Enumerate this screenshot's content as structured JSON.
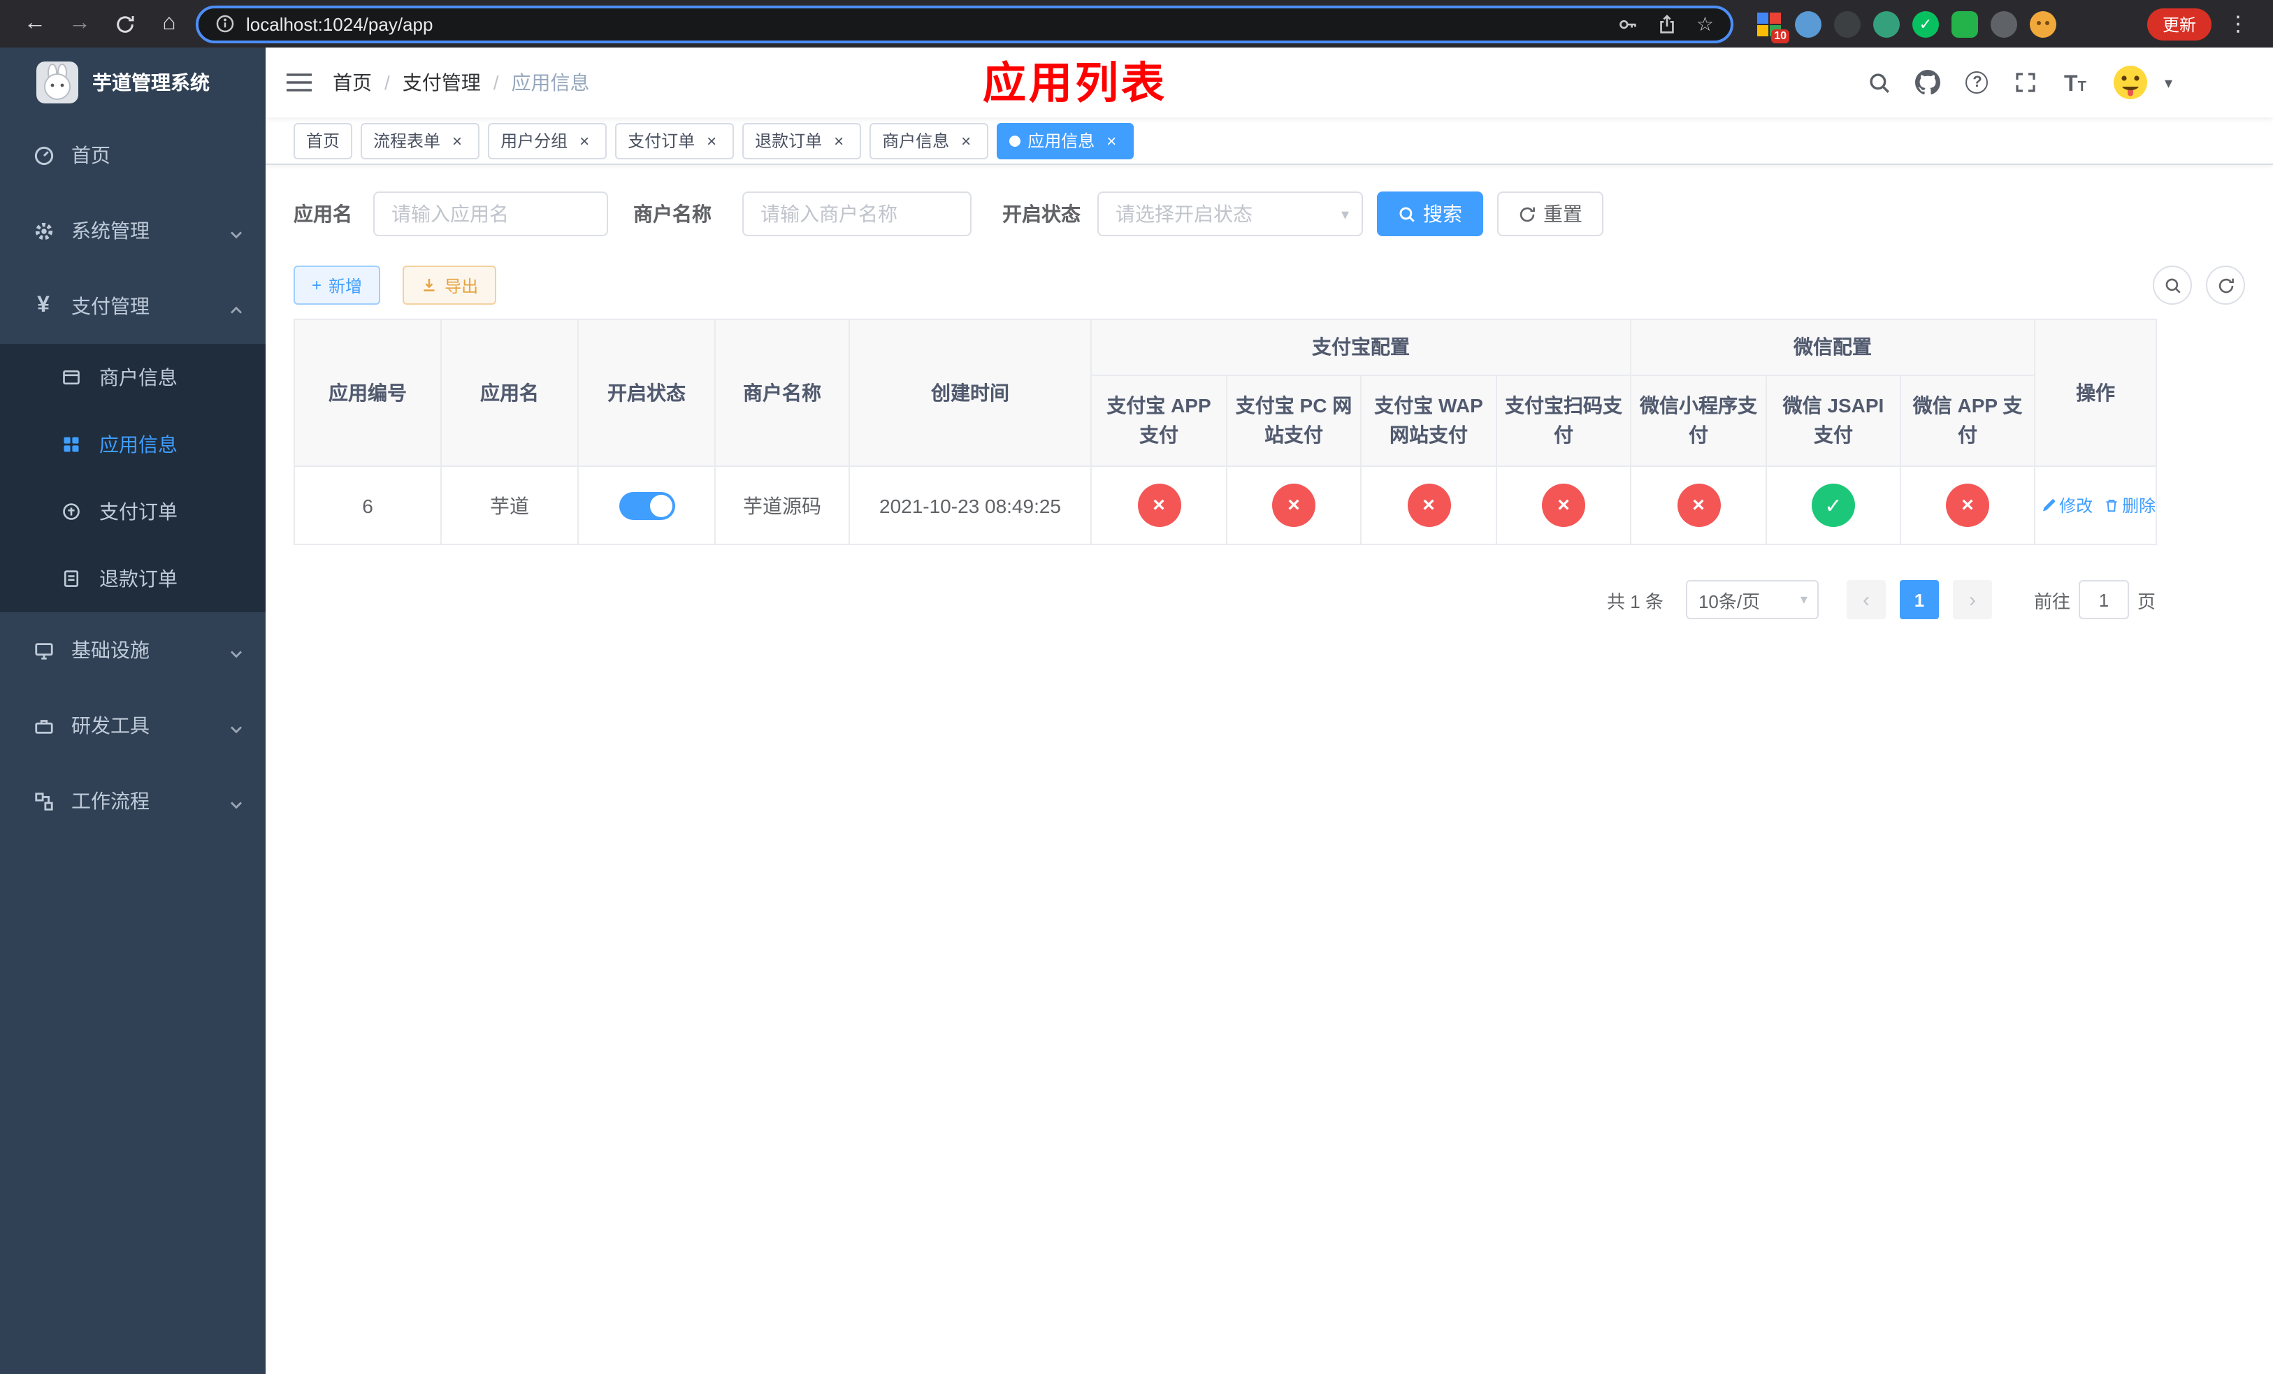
{
  "colors": {
    "primary": "#409eff",
    "danger": "#f45656",
    "success": "#1dc779",
    "warning": "#e6a23c",
    "annotation": "#ff0000",
    "sidebar_bg": "#304156",
    "submenu_bg": "#1f2d3d"
  },
  "icons": {
    "back": "←",
    "forward": "→",
    "home": "⌂",
    "star": "☆",
    "kebab": "⋮",
    "caret_down": "▾",
    "close": "×",
    "plus": "+",
    "check": "✓",
    "cross": "×",
    "prev": "‹",
    "next": "›",
    "question": "?",
    "currency": "¥",
    "font_large": "T",
    "font_small": "T",
    "wechat_check": "✓"
  },
  "browser": {
    "url": "localhost:1024/pay/app",
    "update_button": "更新",
    "extension_badge": "10"
  },
  "sidebar": {
    "title": "芋道管理系统",
    "items": [
      {
        "label": "首页"
      },
      {
        "label": "系统管理"
      },
      {
        "label": "支付管理"
      },
      {
        "label": "基础设施"
      },
      {
        "label": "研发工具"
      },
      {
        "label": "工作流程"
      }
    ],
    "submenu": [
      {
        "label": "商户信息"
      },
      {
        "label": "应用信息"
      },
      {
        "label": "支付订单"
      },
      {
        "label": "退款订单"
      }
    ]
  },
  "header": {
    "breadcrumb": [
      {
        "label": "首页"
      },
      {
        "label": "支付管理"
      },
      {
        "label": "应用信息"
      }
    ],
    "separator": "/",
    "annotation": "应用列表"
  },
  "tabs": [
    {
      "label": "首页"
    },
    {
      "label": "流程表单"
    },
    {
      "label": "用户分组"
    },
    {
      "label": "支付订单"
    },
    {
      "label": "退款订单"
    },
    {
      "label": "商户信息"
    },
    {
      "label": "应用信息"
    }
  ],
  "filters": {
    "app_name_label": "应用名",
    "app_name_placeholder": "请输入应用名",
    "merchant_label": "商户名称",
    "merchant_placeholder": "请输入商户名称",
    "status_label": "开启状态",
    "status_placeholder": "请选择开启状态",
    "search_button": "搜索",
    "reset_button": "重置"
  },
  "toolbar": {
    "add_button": "新增",
    "export_button": "导出"
  },
  "table": {
    "columns": [
      "应用编号",
      "应用名",
      "开启状态",
      "商户名称",
      "创建时间",
      "操作"
    ],
    "groups": [
      {
        "label": "支付宝配置",
        "columns": [
          "支付宝 APP 支付",
          "支付宝 PC 网站支付",
          "支付宝 WAP 网站支付",
          "支付宝扫码支付"
        ]
      },
      {
        "label": "微信配置",
        "columns": [
          "微信小程序支付",
          "微信 JSAPI 支付",
          "微信 APP 支付"
        ]
      }
    ],
    "row": {
      "id": "6",
      "name": "芋道",
      "status_on": true,
      "merchant": "芋道源码",
      "created": "2021-10-23 08:49:25",
      "configs": [
        "error",
        "error",
        "error",
        "error",
        "error",
        "success",
        "error"
      ],
      "edit_label": "修改",
      "delete_label": "删除"
    }
  },
  "pagination": {
    "total": "共 1 条",
    "page_size": "10条/页",
    "page": "1",
    "goto_label": "前往",
    "goto_value": "1",
    "goto_suffix": "页"
  }
}
